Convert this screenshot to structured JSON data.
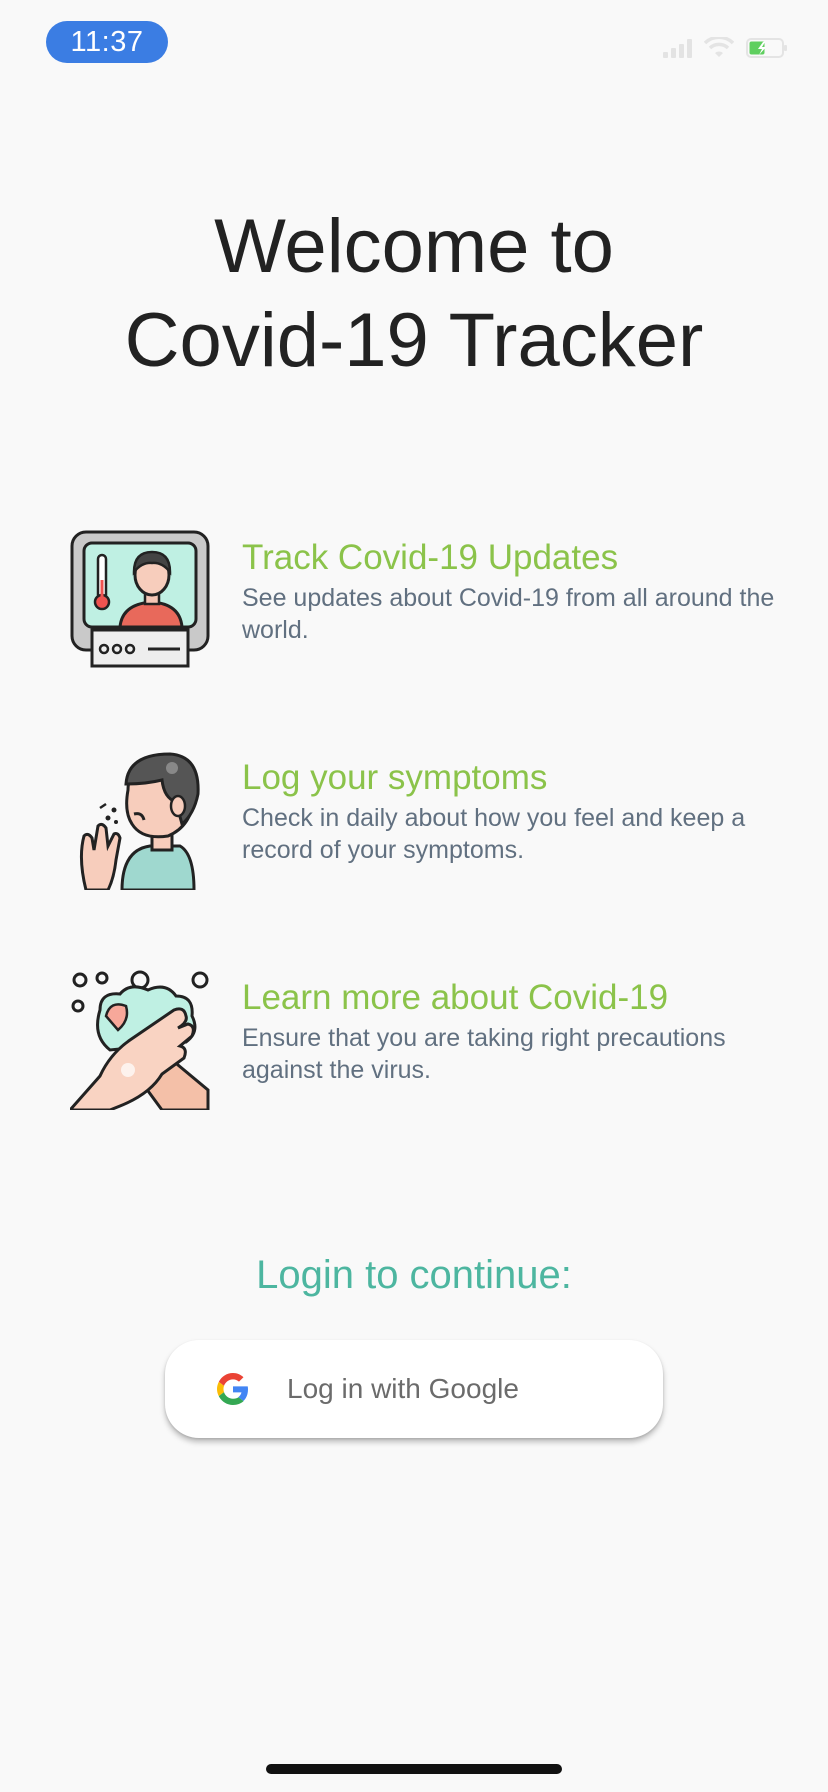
{
  "status_bar": {
    "time": "11:37"
  },
  "title": {
    "line1": "Welcome to",
    "line2": "Covid-19 Tracker"
  },
  "features": [
    {
      "icon": "monitor-doctor-icon",
      "title": "Track Covid-19 Updates",
      "description": "See updates about Covid-19 from all around the world."
    },
    {
      "icon": "coughing-person-icon",
      "title": "Log your symptoms",
      "description": "Check in daily about how you feel and keep a record of your symptoms."
    },
    {
      "icon": "hand-washing-icon",
      "title": "Learn more about Covid-19",
      "description": "Ensure that you are taking right precautions against the virus."
    }
  ],
  "login": {
    "prompt": "Login to continue:",
    "google_button_label": "Log in with Google"
  },
  "colors": {
    "accent_green": "#8bc34a",
    "accent_teal": "#4db6a0",
    "time_pill": "#3b7de3"
  }
}
